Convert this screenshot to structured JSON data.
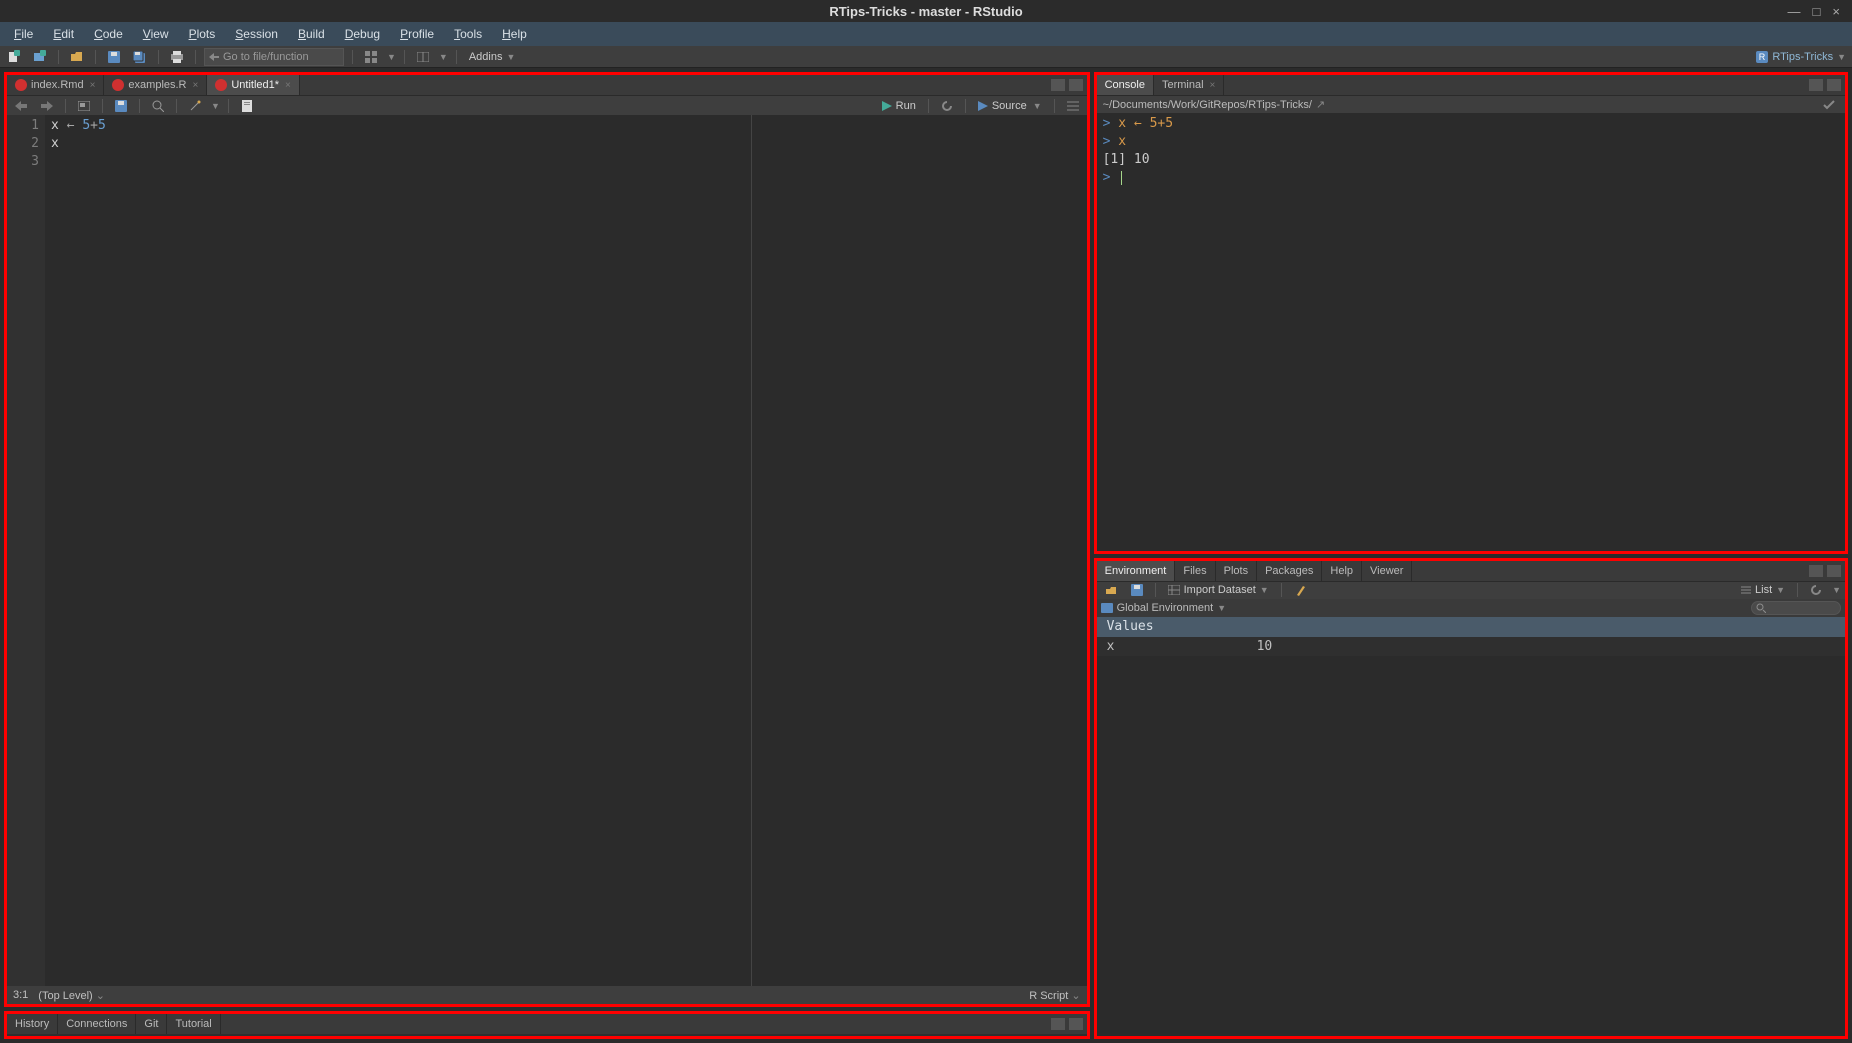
{
  "title": "RTips-Tricks - master - RStudio",
  "menubar": [
    "File",
    "Edit",
    "Code",
    "View",
    "Plots",
    "Session",
    "Build",
    "Debug",
    "Profile",
    "Tools",
    "Help"
  ],
  "toolbar": {
    "search_placeholder": "Go to file/function",
    "addins_label": "Addins",
    "project_label": "RTips-Tricks"
  },
  "editor": {
    "tabs": [
      {
        "label": "index.Rmd",
        "active": false
      },
      {
        "label": "examples.R",
        "active": false
      },
      {
        "label": "Untitled1*",
        "active": true
      }
    ],
    "toolbar": {
      "run": "Run",
      "source": "Source"
    },
    "lines": [
      {
        "n": "1",
        "tokens": [
          {
            "t": "x",
            "c": "var"
          },
          {
            "t": "  ",
            "c": ""
          },
          {
            "t": "←",
            "c": "op"
          },
          {
            "t": "  ",
            "c": ""
          },
          {
            "t": "5",
            "c": "num"
          },
          {
            "t": "+",
            "c": "op"
          },
          {
            "t": "5",
            "c": "num"
          }
        ]
      },
      {
        "n": "2",
        "tokens": [
          {
            "t": "x",
            "c": "var"
          }
        ]
      },
      {
        "n": "3",
        "tokens": []
      }
    ],
    "status": {
      "pos": "3:1",
      "scope": "(Top Level)",
      "type": "R Script"
    }
  },
  "console": {
    "tabs": [
      "Console",
      "Terminal"
    ],
    "active_tab": 0,
    "path": "~/Documents/Work/GitRepos/RTips-Tricks/",
    "lines": [
      {
        "type": "cmd",
        "text": "x ← 5+5"
      },
      {
        "type": "cmd",
        "text": "x"
      },
      {
        "type": "out",
        "text": "[1] 10"
      },
      {
        "type": "prompt",
        "text": ""
      }
    ]
  },
  "environment": {
    "tabs": [
      "Environment",
      "Files",
      "Plots",
      "Packages",
      "Help",
      "Viewer"
    ],
    "active_tab": 0,
    "toolbar": {
      "import": "Import Dataset",
      "list": "List"
    },
    "scope": "Global Environment",
    "header": "Values",
    "rows": [
      {
        "name": "x",
        "value": "10"
      }
    ]
  },
  "bottom": {
    "tabs": [
      "History",
      "Connections",
      "Git",
      "Tutorial"
    ]
  }
}
